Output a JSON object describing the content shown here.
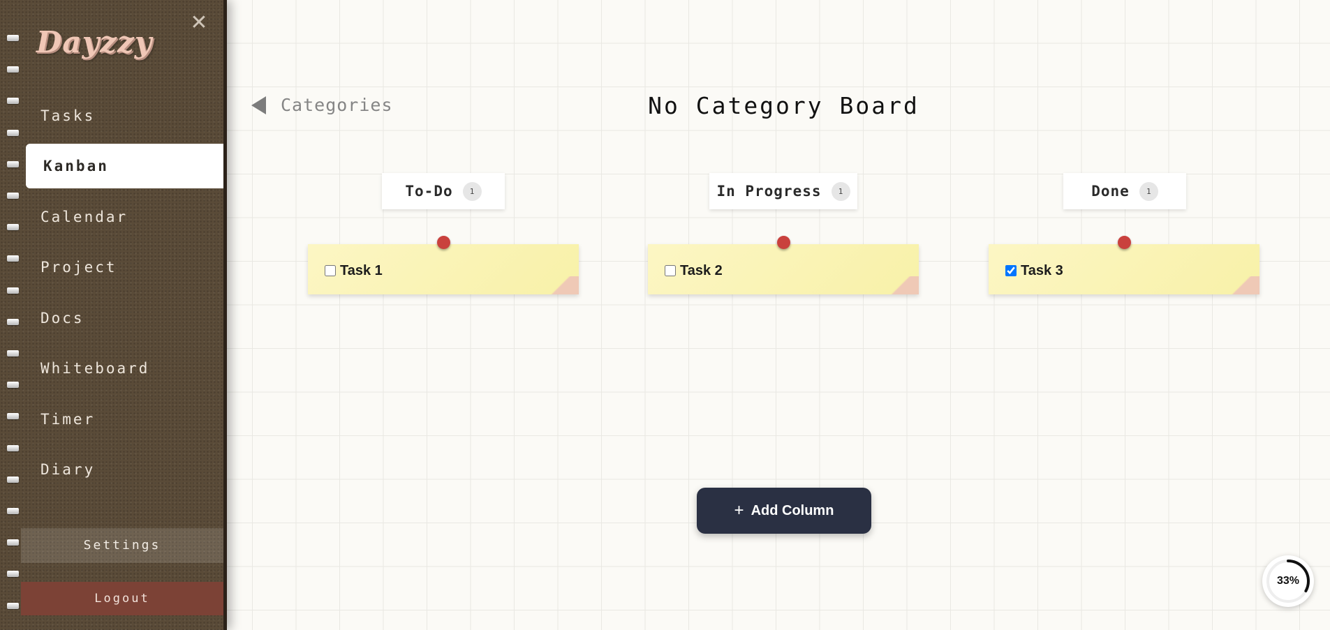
{
  "app": {
    "logo": "Dayzzy",
    "close_icon": "✕"
  },
  "sidebar": {
    "items": [
      {
        "label": "Tasks",
        "active": false
      },
      {
        "label": "Kanban",
        "active": true
      },
      {
        "label": "Calendar",
        "active": false
      },
      {
        "label": "Project",
        "active": false
      },
      {
        "label": "Docs",
        "active": false
      },
      {
        "label": "Whiteboard",
        "active": false
      },
      {
        "label": "Timer",
        "active": false
      },
      {
        "label": "Diary",
        "active": false
      }
    ],
    "settings_label": "Settings",
    "logout_label": "Logout"
  },
  "header": {
    "back_label": "Categories",
    "title": "No Category Board"
  },
  "columns": [
    {
      "title": "To-Do",
      "count": "1",
      "tasks": [
        {
          "label": "Task 1",
          "checked": false
        }
      ]
    },
    {
      "title": "In Progress",
      "count": "1",
      "tasks": [
        {
          "label": "Task 2",
          "checked": false
        }
      ]
    },
    {
      "title": "Done",
      "count": "1",
      "tasks": [
        {
          "label": "Task 3",
          "checked": true
        }
      ]
    }
  ],
  "add_column": {
    "icon": "+",
    "label": "Add Column"
  },
  "progress": {
    "value": 33,
    "label": "33%"
  },
  "colors": {
    "sidebar_leather": "#5a4b38",
    "note_yellow": "#f8f1a8",
    "pin_red": "#c9413d",
    "button_dark": "#2a3043",
    "logout_red": "#7c4236"
  }
}
